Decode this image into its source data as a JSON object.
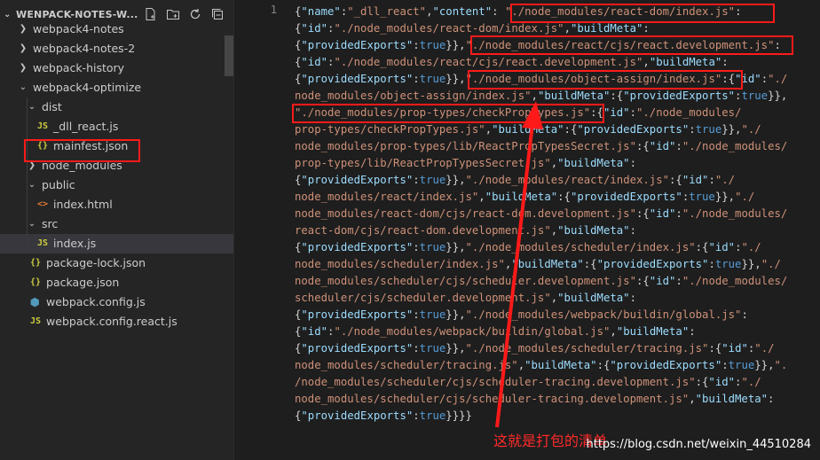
{
  "explorer": {
    "title": "WENPACK-NOTES-W...",
    "actions": [
      "new-file-icon",
      "new-folder-icon",
      "refresh-icon",
      "collapse-all-icon"
    ],
    "tree": [
      {
        "label": "webpack4-notes",
        "type": "folder",
        "expanded": false,
        "depth": 0
      },
      {
        "label": "webpack4-notes-2",
        "type": "folder",
        "expanded": false,
        "depth": 0
      },
      {
        "label": "webpack-history",
        "type": "folder",
        "expanded": false,
        "depth": 0
      },
      {
        "label": "webpack4-optimize",
        "type": "folder",
        "expanded": true,
        "depth": 0
      },
      {
        "label": "dist",
        "type": "folder",
        "expanded": true,
        "depth": 1
      },
      {
        "label": "_dll_react.js",
        "type": "js",
        "depth": 2
      },
      {
        "label": "mainfest.json",
        "type": "json",
        "depth": 2,
        "selected": true
      },
      {
        "label": "node_modules",
        "type": "folder",
        "expanded": false,
        "depth": 1
      },
      {
        "label": "public",
        "type": "folder",
        "expanded": true,
        "depth": 1
      },
      {
        "label": "index.html",
        "type": "html",
        "depth": 2
      },
      {
        "label": "src",
        "type": "folder",
        "expanded": true,
        "depth": 1
      },
      {
        "label": "index.js",
        "type": "js",
        "depth": 2,
        "active": true
      },
      {
        "label": "package-lock.json",
        "type": "json",
        "depth": 1
      },
      {
        "label": "package.json",
        "type": "json",
        "depth": 1
      },
      {
        "label": "webpack.config.js",
        "type": "cfg",
        "depth": 1
      },
      {
        "label": "webpack.config.react.js",
        "type": "js",
        "depth": 1
      }
    ]
  },
  "editor": {
    "line_number": "1",
    "code_lines": [
      [
        [
          "p",
          "{"
        ],
        [
          "k",
          "\"name\""
        ],
        [
          "p",
          ":"
        ],
        [
          "s",
          "\"_dll_react\""
        ],
        [
          "p",
          ","
        ],
        [
          "k",
          "\"content\""
        ],
        [
          "p",
          ": "
        ],
        [
          "s",
          "\"./node_modules/react-dom/index.js\""
        ],
        [
          "p",
          ":"
        ]
      ],
      [
        [
          "p",
          "{"
        ],
        [
          "k",
          "\"id\""
        ],
        [
          "p",
          ":"
        ],
        [
          "s",
          "\"./node_modules/react-dom/index.js\""
        ],
        [
          "p",
          ","
        ],
        [
          "k",
          "\"buildMeta\""
        ],
        [
          "p",
          ":"
        ]
      ],
      [
        [
          "p",
          "{"
        ],
        [
          "k",
          "\"providedExports\""
        ],
        [
          "p",
          ":"
        ],
        [
          "b",
          "true"
        ],
        [
          "p",
          "}},"
        ],
        [
          "s",
          "\"./node_modules/react/cjs/react.development.js\""
        ],
        [
          "p",
          ":"
        ]
      ],
      [
        [
          "p",
          "{"
        ],
        [
          "k",
          "\"id\""
        ],
        [
          "p",
          ":"
        ],
        [
          "s",
          "\"./node_modules/react/cjs/react.development.js\""
        ],
        [
          "p",
          ","
        ],
        [
          "k",
          "\"buildMeta\""
        ],
        [
          "p",
          ":"
        ]
      ],
      [
        [
          "p",
          "{"
        ],
        [
          "k",
          "\"providedExports\""
        ],
        [
          "p",
          ":"
        ],
        [
          "b",
          "true"
        ],
        [
          "p",
          "}},"
        ],
        [
          "s",
          "\"./node_modules/object-assign/index.js\""
        ],
        [
          "p",
          ":{"
        ],
        [
          "k",
          "\"id\""
        ],
        [
          "p",
          ":"
        ],
        [
          "s",
          "\"./"
        ]
      ],
      [
        [
          "s",
          "node_modules/object-assign/index.js\""
        ],
        [
          "p",
          ","
        ],
        [
          "k",
          "\"buildMeta\""
        ],
        [
          "p",
          ":{"
        ],
        [
          "k",
          "\"providedExports\""
        ],
        [
          "p",
          ":"
        ],
        [
          "b",
          "true"
        ],
        [
          "p",
          "}},"
        ]
      ],
      [
        [
          "s",
          "\"./node_modules/prop-types/checkPropTypes.js\""
        ],
        [
          "p",
          ":{"
        ],
        [
          "k",
          "\"id\""
        ],
        [
          "p",
          ":"
        ],
        [
          "s",
          "\"./node_modules/"
        ]
      ],
      [
        [
          "s",
          "prop-types/checkPropTypes.js\""
        ],
        [
          "p",
          ","
        ],
        [
          "k",
          "\"buildMeta\""
        ],
        [
          "p",
          ":{"
        ],
        [
          "k",
          "\"providedExports\""
        ],
        [
          "p",
          ":"
        ],
        [
          "b",
          "true"
        ],
        [
          "p",
          "}},"
        ],
        [
          "s",
          "\"./"
        ]
      ],
      [
        [
          "s",
          "node_modules/prop-types/lib/ReactPropTypesSecret.js\""
        ],
        [
          "p",
          ":{"
        ],
        [
          "k",
          "\"id\""
        ],
        [
          "p",
          ":"
        ],
        [
          "s",
          "\"./node_modules/"
        ]
      ],
      [
        [
          "s",
          "prop-types/lib/ReactPropTypesSecret.js\""
        ],
        [
          "p",
          ","
        ],
        [
          "k",
          "\"buildMeta\""
        ],
        [
          "p",
          ":"
        ]
      ],
      [
        [
          "p",
          "{"
        ],
        [
          "k",
          "\"providedExports\""
        ],
        [
          "p",
          ":"
        ],
        [
          "b",
          "true"
        ],
        [
          "p",
          "}},"
        ],
        [
          "s",
          "\"./node_modules/react/index.js\""
        ],
        [
          "p",
          ":{"
        ],
        [
          "k",
          "\"id\""
        ],
        [
          "p",
          ":"
        ],
        [
          "s",
          "\"./"
        ]
      ],
      [
        [
          "s",
          "node_modules/react/index.js\""
        ],
        [
          "p",
          ","
        ],
        [
          "k",
          "\"buildMeta\""
        ],
        [
          "p",
          ":{"
        ],
        [
          "k",
          "\"providedExports\""
        ],
        [
          "p",
          ":"
        ],
        [
          "b",
          "true"
        ],
        [
          "p",
          "}},"
        ],
        [
          "s",
          "\"./"
        ]
      ],
      [
        [
          "s",
          "node_modules/react-dom/cjs/react-dom.development.js\""
        ],
        [
          "p",
          ":{"
        ],
        [
          "k",
          "\"id\""
        ],
        [
          "p",
          ":"
        ],
        [
          "s",
          "\"./node_modules/"
        ]
      ],
      [
        [
          "s",
          "react-dom/cjs/react-dom.development.js\""
        ],
        [
          "p",
          ","
        ],
        [
          "k",
          "\"buildMeta\""
        ],
        [
          "p",
          ":"
        ]
      ],
      [
        [
          "p",
          "{"
        ],
        [
          "k",
          "\"providedExports\""
        ],
        [
          "p",
          ":"
        ],
        [
          "b",
          "true"
        ],
        [
          "p",
          "}},"
        ],
        [
          "s",
          "\"./node_modules/scheduler/index.js\""
        ],
        [
          "p",
          ":{"
        ],
        [
          "k",
          "\"id\""
        ],
        [
          "p",
          ":"
        ],
        [
          "s",
          "\"./"
        ]
      ],
      [
        [
          "s",
          "node_modules/scheduler/index.js\""
        ],
        [
          "p",
          ","
        ],
        [
          "k",
          "\"buildMeta\""
        ],
        [
          "p",
          ":{"
        ],
        [
          "k",
          "\"providedExports\""
        ],
        [
          "p",
          ":"
        ],
        [
          "b",
          "true"
        ],
        [
          "p",
          "}},"
        ],
        [
          "s",
          "\"./"
        ]
      ],
      [
        [
          "s",
          "node_modules/scheduler/cjs/scheduler.development.js\""
        ],
        [
          "p",
          ":{"
        ],
        [
          "k",
          "\"id\""
        ],
        [
          "p",
          ":"
        ],
        [
          "s",
          "\"./node_modules/"
        ]
      ],
      [
        [
          "s",
          "scheduler/cjs/scheduler.development.js\""
        ],
        [
          "p",
          ","
        ],
        [
          "k",
          "\"buildMeta\""
        ],
        [
          "p",
          ":"
        ]
      ],
      [
        [
          "p",
          "{"
        ],
        [
          "k",
          "\"providedExports\""
        ],
        [
          "p",
          ":"
        ],
        [
          "b",
          "true"
        ],
        [
          "p",
          "}},"
        ],
        [
          "s",
          "\"./node_modules/webpack/buildin/global.js\""
        ],
        [
          "p",
          ":"
        ]
      ],
      [
        [
          "p",
          "{"
        ],
        [
          "k",
          "\"id\""
        ],
        [
          "p",
          ":"
        ],
        [
          "s",
          "\"./node_modules/webpack/buildin/global.js\""
        ],
        [
          "p",
          ","
        ],
        [
          "k",
          "\"buildMeta\""
        ],
        [
          "p",
          ":"
        ]
      ],
      [
        [
          "p",
          "{"
        ],
        [
          "k",
          "\"providedExports\""
        ],
        [
          "p",
          ":"
        ],
        [
          "b",
          "true"
        ],
        [
          "p",
          "}},"
        ],
        [
          "s",
          "\"./node_modules/scheduler/tracing.js\""
        ],
        [
          "p",
          ":{"
        ],
        [
          "k",
          "\"id\""
        ],
        [
          "p",
          ":"
        ],
        [
          "s",
          "\"./"
        ]
      ],
      [
        [
          "s",
          "node_modules/scheduler/tracing.js\""
        ],
        [
          "p",
          ","
        ],
        [
          "k",
          "\"buildMeta\""
        ],
        [
          "p",
          ":{"
        ],
        [
          "k",
          "\"providedExports\""
        ],
        [
          "p",
          ":"
        ],
        [
          "b",
          "true"
        ],
        [
          "p",
          "}},"
        ],
        [
          "s",
          "\"."
        ]
      ],
      [
        [
          "s",
          "/node_modules/scheduler/cjs/scheduler-tracing.development.js\""
        ],
        [
          "p",
          ":{"
        ],
        [
          "k",
          "\"id\""
        ],
        [
          "p",
          ":"
        ],
        [
          "s",
          "\"./"
        ]
      ],
      [
        [
          "s",
          "node_modules/scheduler/cjs/scheduler-tracing.development.js\""
        ],
        [
          "p",
          ","
        ],
        [
          "k",
          "\"buildMeta\""
        ],
        [
          "p",
          ":"
        ]
      ],
      [
        [
          "p",
          "{"
        ],
        [
          "k",
          "\"providedExports\""
        ],
        [
          "p",
          ":"
        ],
        [
          "b",
          "true"
        ],
        [
          "p",
          "}}}"
        ],
        [
          "p",
          "}"
        ]
      ]
    ]
  },
  "annotation": {
    "text": "这就是打包的清单",
    "color": "#ff2a2a"
  },
  "watermark": "https://blog.csdn.net/weixin_44510284",
  "colors": {
    "sidebar_bg": "#252526",
    "editor_bg": "#1e1e1e",
    "json_key": "#9cdcfe",
    "json_string": "#ce9178",
    "json_bool": "#569cd6",
    "highlight_box": "#ff1a1a"
  }
}
